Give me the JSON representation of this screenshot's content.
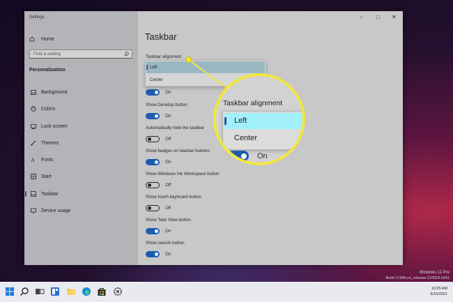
{
  "window": {
    "title": "Settings",
    "controls": {
      "minimize": "–",
      "maximize": "□",
      "close": "✕"
    }
  },
  "sidebar": {
    "home_label": "Home",
    "search_placeholder": "Find a setting",
    "section_title": "Personalization",
    "items": [
      {
        "label": "Background",
        "icon": "image-icon"
      },
      {
        "label": "Colors",
        "icon": "palette-icon"
      },
      {
        "label": "Lock screen",
        "icon": "lock-screen-icon"
      },
      {
        "label": "Themes",
        "icon": "brush-icon"
      },
      {
        "label": "Fonts",
        "icon": "font-icon"
      },
      {
        "label": "Start",
        "icon": "start-icon"
      },
      {
        "label": "Taskbar",
        "icon": "taskbar-icon",
        "active": true
      },
      {
        "label": "Device usage",
        "icon": "device-icon"
      }
    ]
  },
  "main": {
    "title": "Taskbar",
    "alignment_label": "Taskbar alignment",
    "alignment_options": [
      "Left",
      "Center"
    ],
    "alignment_selected": "Left",
    "settings": [
      {
        "label": "",
        "state": "On"
      },
      {
        "label": "Show Desktop button",
        "state": "On"
      },
      {
        "label": "Automatically hide the taskbar",
        "state": "Off"
      },
      {
        "label": "Show badges on taskbar buttons",
        "state": "On"
      },
      {
        "label": "Show Windows Ink Workspace button",
        "state": "Off"
      },
      {
        "label": "Show touch keyboard button",
        "state": "Off"
      },
      {
        "label": "Show Task View button",
        "state": "On"
      },
      {
        "label": "Show search button",
        "state": "On"
      }
    ]
  },
  "magnifier": {
    "label": "Taskbar alignment",
    "options": [
      "Left",
      "Center"
    ],
    "toggle_state": "On",
    "accent_color": "#f2e640"
  },
  "watermark": {
    "line1": "Windows 11 Pro",
    "line2": "Build 21996.co_release.210529-1541"
  },
  "taskbar": {
    "time": "10:25 AM",
    "date": "6/15/2021"
  },
  "colors": {
    "toggle_on": "#1b5cb0",
    "selection_highlight": "#a2f0fb"
  }
}
